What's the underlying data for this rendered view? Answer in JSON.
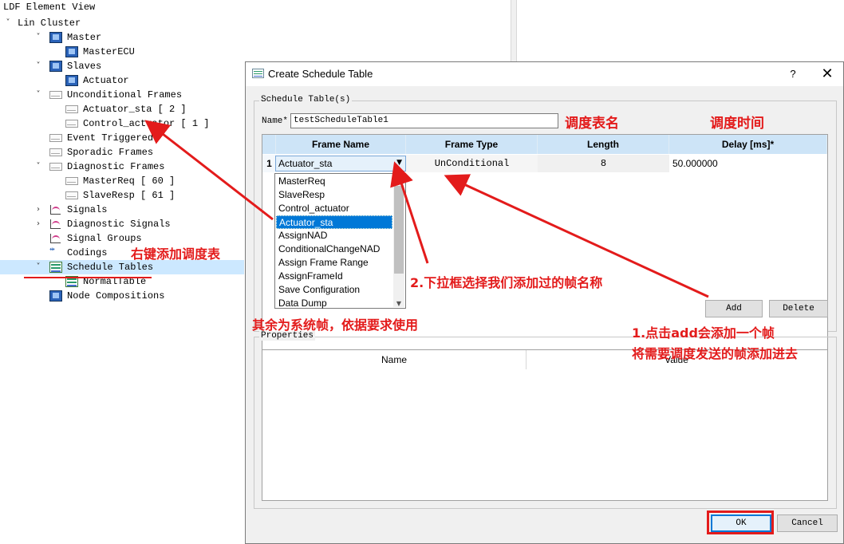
{
  "left_panel": {
    "title": "LDF Element View",
    "tree": [
      {
        "label": "Lin Cluster",
        "toggle": "˅",
        "icon": "none"
      },
      {
        "label": "Master",
        "toggle": "˅",
        "icon": "monitor-icon"
      },
      {
        "label": "MasterECU",
        "toggle": "",
        "icon": "monitor-icon"
      },
      {
        "label": "Slaves",
        "toggle": "˅",
        "icon": "monitor-icon"
      },
      {
        "label": "Actuator",
        "toggle": "",
        "icon": "monitor-icon"
      },
      {
        "label": "Unconditional Frames",
        "toggle": "˅",
        "icon": "envelope-icon"
      },
      {
        "label": "Actuator_sta [ 2 ]",
        "toggle": "",
        "icon": "envelope-icon"
      },
      {
        "label": "Control_actuator [ 1 ]",
        "toggle": "",
        "icon": "envelope-icon"
      },
      {
        "label": "Event Triggered",
        "toggle": "",
        "icon": "envelope-icon"
      },
      {
        "label": "Sporadic Frames",
        "toggle": "",
        "icon": "envelope-icon"
      },
      {
        "label": "Diagnostic Frames",
        "toggle": "˅",
        "icon": "envelope-icon"
      },
      {
        "label": "MasterReq [ 60 ]",
        "toggle": "",
        "icon": "envelope-icon"
      },
      {
        "label": "SlaveResp [ 61 ]",
        "toggle": "",
        "icon": "envelope-icon"
      },
      {
        "label": "Signals",
        "toggle": "›",
        "icon": "signal-chart-icon"
      },
      {
        "label": "Diagnostic Signals",
        "toggle": "›",
        "icon": "signal-chart-icon"
      },
      {
        "label": "Signal Groups",
        "toggle": "",
        "icon": "signal-chart-icon"
      },
      {
        "label": "Codings",
        "toggle": "",
        "icon": "codings-icon"
      },
      {
        "label": "Schedule Tables",
        "toggle": "˅",
        "icon": "schedule-table-icon"
      },
      {
        "label": "NormalTable",
        "toggle": "",
        "icon": "schedule-table-icon"
      },
      {
        "label": "Node Compositions",
        "toggle": "",
        "icon": "monitor-icon"
      }
    ]
  },
  "dialog": {
    "title": "Create Schedule Table",
    "help": "?",
    "close": "✕",
    "schedule_group_label": "Schedule Table(s)",
    "name_label": "Name*",
    "name_value": "testScheduleTable1",
    "grid": {
      "headers": [
        "Frame Name",
        "Frame Type",
        "Length",
        "Delay [ms]*"
      ],
      "rows": [
        {
          "index": "1",
          "frame_name": "Actuator_sta",
          "frame_type": "UnConditional",
          "length": "8",
          "delay": "50.000000"
        }
      ]
    },
    "dropdown": {
      "options": [
        "MasterReq",
        "SlaveResp",
        "Control_actuator",
        "Actuator_sta",
        "AssignNAD",
        "ConditionalChangeNAD",
        "Assign Frame Range",
        "AssignFrameId",
        "Save Configuration",
        "Data Dump"
      ],
      "selected": "Actuator_sta"
    },
    "add_label": "Add",
    "delete_label": "Delete",
    "properties_label": "Properties",
    "properties_headers": [
      "Name",
      "Value"
    ],
    "ok_label": "OK",
    "cancel_label": "Cancel"
  },
  "annotations": {
    "table_name": "调度表名",
    "schedule_time": "调度时间",
    "right_click": "右键添加调度表",
    "dropdown_hint": "2.下拉框选择我们添加过的帧名称",
    "system_frames": "其余为系统帧，依据要求使用",
    "add_hint_1": "1.点击add会添加一个帧",
    "add_hint_2": "将需要调度发送的帧添加进去",
    "color": "#e31b1b"
  }
}
